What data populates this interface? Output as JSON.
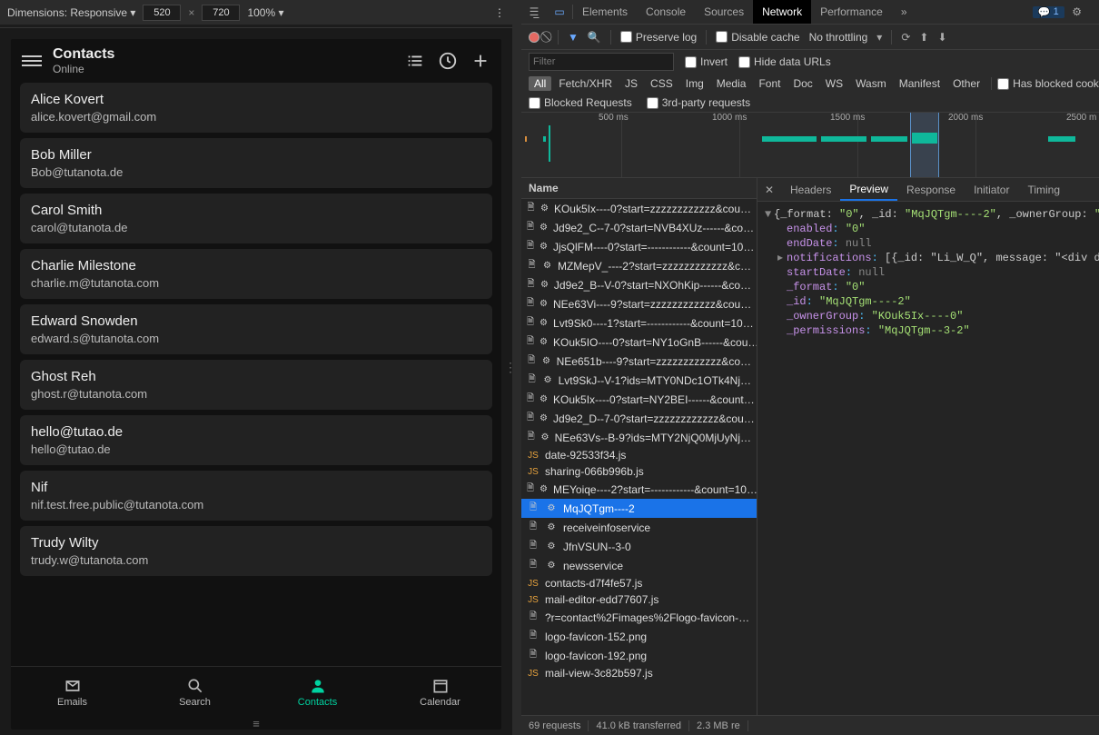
{
  "responsive_bar": {
    "dimensions_label": "Dimensions: Responsive ▾",
    "width": "520",
    "height": "720",
    "zoom": "100% ▾"
  },
  "app": {
    "title": "Contacts",
    "subtitle": "Online",
    "contacts": [
      {
        "name": "Alice Kovert",
        "email": "alice.kovert@gmail.com"
      },
      {
        "name": "Bob Miller",
        "email": "Bob@tutanota.de"
      },
      {
        "name": "Carol Smith",
        "email": "carol@tutanota.de"
      },
      {
        "name": "Charlie Milestone",
        "email": "charlie.m@tutanota.com"
      },
      {
        "name": "Edward Snowden",
        "email": "edward.s@tutanota.com"
      },
      {
        "name": "Ghost Reh",
        "email": "ghost.r@tutanota.com"
      },
      {
        "name": "hello@tutao.de",
        "email": "hello@tutao.de"
      },
      {
        "name": "Nif",
        "email": "nif.test.free.public@tutanota.com"
      },
      {
        "name": "Trudy Wilty",
        "email": "trudy.w@tutanota.com"
      }
    ],
    "nav": {
      "emails": "Emails",
      "search": "Search",
      "contacts": "Contacts",
      "calendar": "Calendar"
    }
  },
  "devtools": {
    "tabs": {
      "elements": "Elements",
      "console": "Console",
      "sources": "Sources",
      "network": "Network",
      "performance": "Performance",
      "more": "»"
    },
    "issues_count": "1"
  },
  "net_toolbar": {
    "preserve_log": "Preserve log",
    "disable_cache": "Disable cache",
    "throttling": "No throttling"
  },
  "filter_row": {
    "filter_placeholder": "Filter",
    "invert": "Invert",
    "hide_urls": "Hide data URLs"
  },
  "types": [
    "All",
    "Fetch/XHR",
    "JS",
    "CSS",
    "Img",
    "Media",
    "Font",
    "Doc",
    "WS",
    "Wasm",
    "Manifest",
    "Other"
  ],
  "blocked_cookies": "Has blocked cookies",
  "blocked_requests": "Blocked Requests",
  "third_party": "3rd-party requests",
  "timeline_ticks": [
    "500 ms",
    "1000 ms",
    "1500 ms",
    "2000 ms",
    "2500 m"
  ],
  "req_header": "Name",
  "requests": [
    {
      "t": "gear",
      "n": "KOuk5Ix----0?start=zzzzzzzzzzzz&cou…"
    },
    {
      "t": "gear",
      "n": "Jd9e2_C--7-0?start=NVB4XUz------&co…"
    },
    {
      "t": "gear",
      "n": "JjsQlFM----0?start=------------&count=10…"
    },
    {
      "t": "gear",
      "n": "MZMepV_----2?start=zzzzzzzzzzzz&c…"
    },
    {
      "t": "gear",
      "n": "Jd9e2_B--V-0?start=NXOhKip------&co…"
    },
    {
      "t": "gear",
      "n": "NEe63Vi----9?start=zzzzzzzzzzzz&cou…"
    },
    {
      "t": "gear",
      "n": "Lvt9Sk0----1?start=------------&count=10…"
    },
    {
      "t": "gear",
      "n": "KOuk5IO----0?start=NY1oGnB------&cou…"
    },
    {
      "t": "gear",
      "n": "NEe651b----9?start=zzzzzzzzzzzz&co…"
    },
    {
      "t": "gear",
      "n": "Lvt9SkJ--V-1?ids=MTY0NDc1OTk4Nj…"
    },
    {
      "t": "gear",
      "n": "KOuk5Ix----0?start=NY2BEI------&count…"
    },
    {
      "t": "gear",
      "n": "Jd9e2_D--7-0?start=zzzzzzzzzzzz&cou…"
    },
    {
      "t": "gear",
      "n": "NEe63Vs--B-9?ids=MTY2NjQ0MjUyNj…"
    },
    {
      "t": "js",
      "n": "date-92533f34.js"
    },
    {
      "t": "js",
      "n": "sharing-066b996b.js"
    },
    {
      "t": "gear",
      "n": "MEYoiqe----2?start=------------&count=10…"
    },
    {
      "t": "gear",
      "n": "MqJQTgm----2",
      "sel": true
    },
    {
      "t": "gear",
      "n": "receiveinfoservice"
    },
    {
      "t": "gear",
      "n": "JfnVSUN--3-0"
    },
    {
      "t": "gear",
      "n": "newsservice"
    },
    {
      "t": "js",
      "n": "contacts-d7f4fe57.js"
    },
    {
      "t": "js",
      "n": "mail-editor-edd77607.js"
    },
    {
      "t": "doc",
      "n": "?r=contact%2Fimages%2Flogo-favicon-…"
    },
    {
      "t": "doc",
      "n": "logo-favicon-152.png"
    },
    {
      "t": "doc",
      "n": "logo-favicon-192.png"
    },
    {
      "t": "js",
      "n": "mail-view-3c82b597.js"
    }
  ],
  "status": {
    "requests": "69 requests",
    "transferred": "41.0 kB transferred",
    "resources": "2.3 MB re"
  },
  "detail_tabs": {
    "headers": "Headers",
    "preview": "Preview",
    "response": "Response",
    "initiator": "Initiator",
    "timing": "Timing"
  },
  "preview": {
    "line0_pre": "{_format: ",
    "line0_v0": "\"0\"",
    "line0_k1": ", _id: ",
    "line0_v1": "\"MqJQTgm----2\"",
    "line0_k2": ", _ownerGroup: ",
    "line0_v2": "\"KOuk",
    "enabled_k": "enabled",
    "enabled_v": "\"0\"",
    "endDate_k": "endDate",
    "endDate_v": "null",
    "notifications_k": "notifications",
    "notifications_v": "[{_id: \"Li_W_Q\", message: \"<div dir=\"a",
    "startDate_k": "startDate",
    "startDate_v": "null",
    "format_k": "_format",
    "format_v": "\"0\"",
    "id_k": "_id",
    "id_v": "\"MqJQTgm----2\"",
    "owner_k": "_ownerGroup",
    "owner_v": "\"KOuk5Ix----0\"",
    "perm_k": "_permissions",
    "perm_v": "\"MqJQTgm--3-2\""
  }
}
